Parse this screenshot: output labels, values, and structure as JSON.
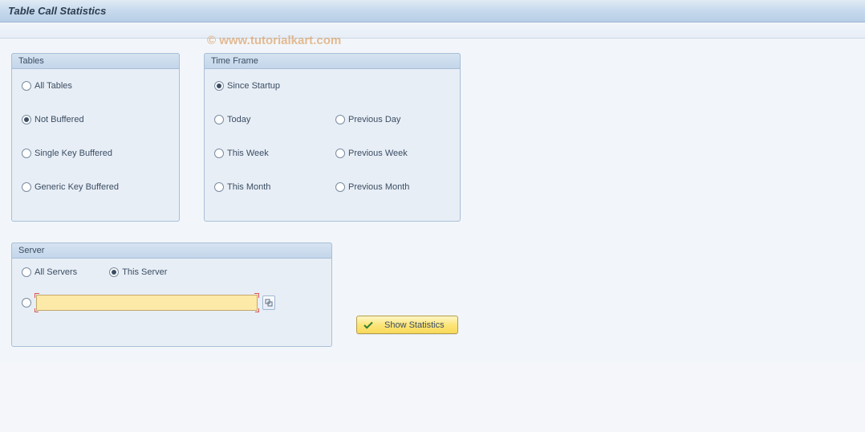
{
  "header": {
    "title": "Table Call Statistics"
  },
  "watermark": "© www.tutorialkart.com",
  "groups": {
    "tables": {
      "title": "Tables",
      "options": {
        "all": "All Tables",
        "not_buffered": "Not Buffered",
        "single_key": "Single Key Buffered",
        "generic_key": "Generic Key Buffered"
      },
      "selected": "not_buffered"
    },
    "timeframe": {
      "title": "Time Frame",
      "options": {
        "since_startup": "Since Startup",
        "today": "Today",
        "prev_day": "Previous Day",
        "this_week": "This Week",
        "prev_week": "Previous Week",
        "this_month": "This Month",
        "prev_month": "Previous Month"
      },
      "selected": "since_startup"
    },
    "server": {
      "title": "Server",
      "options": {
        "all": "All Servers",
        "this": "This Server",
        "custom": ""
      },
      "selected": "this",
      "custom_value": ""
    }
  },
  "buttons": {
    "show_stats": "Show Statistics"
  }
}
